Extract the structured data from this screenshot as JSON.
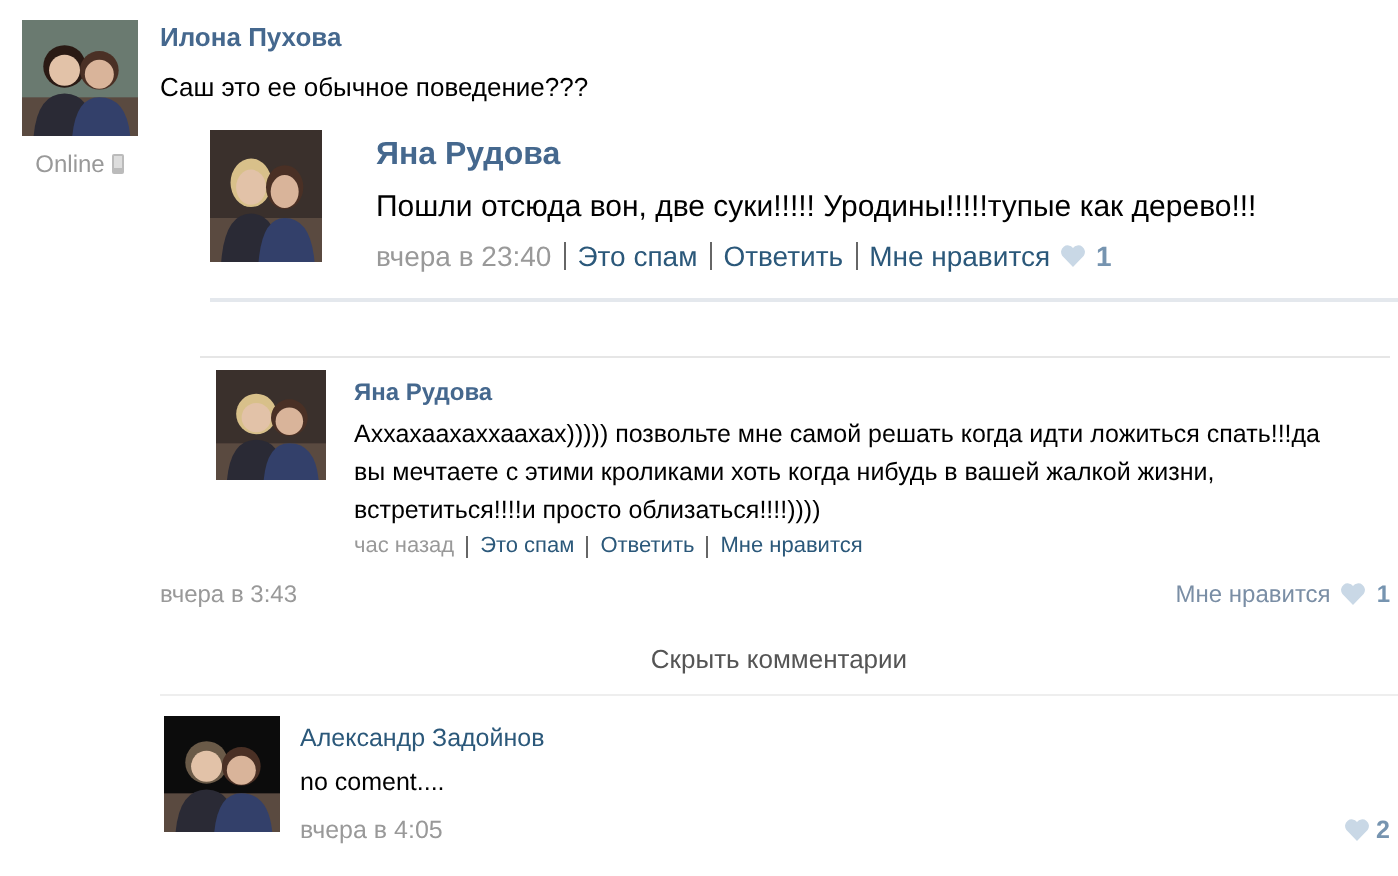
{
  "post": {
    "author": "Илона Пухова",
    "text": "Саш это ее обычное поведение???",
    "status": "Online"
  },
  "quoted_reply": {
    "author": "Яна Рудова",
    "text": "Пошли отсюда вон, две суки!!!!! Уродины!!!!!тупые как дерево!!!",
    "time": "вчера в 23:40",
    "actions": [
      "Это спам",
      "Ответить",
      "Мне нравится"
    ],
    "likes": "1"
  },
  "reply": {
    "author": "Яна Рудова",
    "text": "Аххахаахаххаахах))))) позвольте мне самой решать когда идти ложиться спать!!!да вы мечтаете с этими кроликами хоть когда нибудь в вашей жалкой жизни, встретиться!!!!и просто облизаться!!!!))))",
    "time": "час назад",
    "actions": [
      "Это спам",
      "Ответить",
      "Мне нравится"
    ]
  },
  "post_footer": {
    "time": "вчера в 3:43",
    "like_label": "Мне нравится",
    "likes": "1"
  },
  "hide_comments": "Скрыть комментарии",
  "comment": {
    "author": "Александр Задойнов",
    "text": "no coment....",
    "time": "вчера в 4:05",
    "likes": "2"
  }
}
